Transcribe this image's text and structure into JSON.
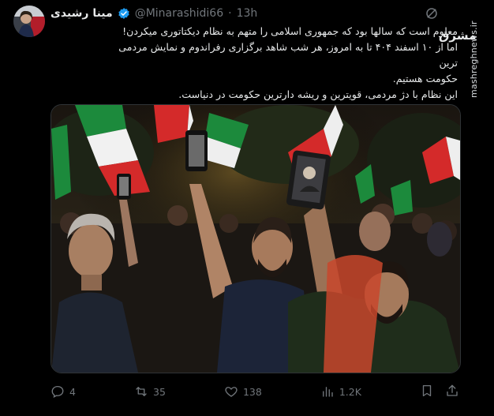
{
  "author": {
    "name": "مینا رشیدی",
    "handle": "@Minarashidi66",
    "separator": "·",
    "time": "13h",
    "verified": true
  },
  "tweet": {
    "lines": [
      "معلوم است که سالها بود که جمهوری اسلامی را متهم به نظام دیکتاتوری میکردن!",
      "اما از ۱۰ اسفند ۴۰۴ تا به امروز، هر شب شاهد برگزاری رفراندوم و نمایش مردمی ترین",
      "حکومت هستیم.",
      "این نظام با دژ مردمی، قویترین و ریشه دارترین حکومت در دنیاست."
    ]
  },
  "watermark": {
    "site": "mashreghnews.ir",
    "logo": "مشرق"
  },
  "actions": {
    "replies": "4",
    "reposts": "35",
    "likes": "138",
    "views": "1.2K"
  },
  "icons": {
    "verified": "verified-badge-icon",
    "grok": "grok-icon",
    "more": "more-icon",
    "reply": "reply-icon",
    "repost": "repost-icon",
    "like": "heart-icon",
    "views": "views-icon",
    "bookmark": "bookmark-icon",
    "share": "share-icon"
  },
  "colors": {
    "background": "#000000",
    "text": "#e7e9ea",
    "muted": "#71767b",
    "verified": "#1d9bf0",
    "border": "#2f3336"
  }
}
